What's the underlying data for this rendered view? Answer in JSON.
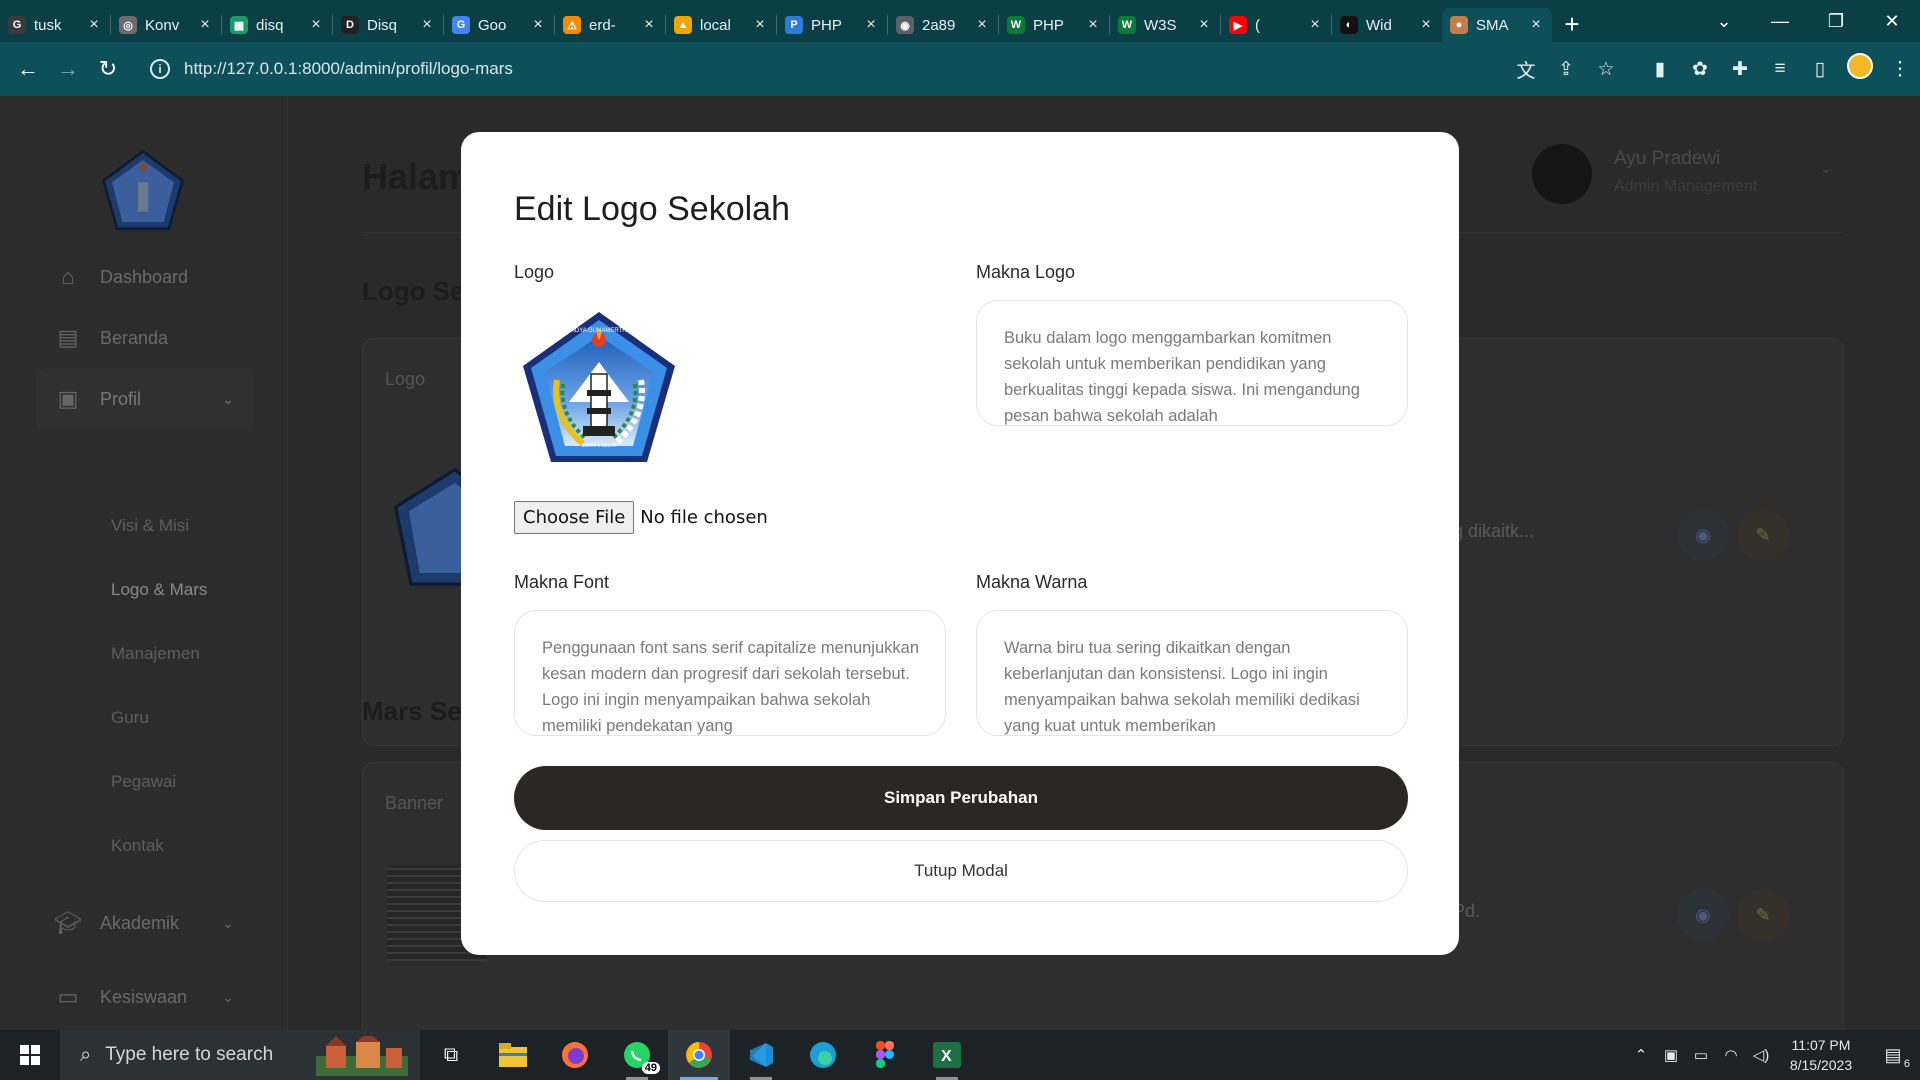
{
  "browser": {
    "tabs": [
      {
        "label": "tusk",
        "color": "#3a3a3a",
        "glyph": "G"
      },
      {
        "label": "Konv",
        "color": "#6b6b6b",
        "glyph": "◎"
      },
      {
        "label": "disq",
        "color": "#1a9c6a",
        "glyph": "▦"
      },
      {
        "label": "Disq",
        "color": "#222222",
        "glyph": "D"
      },
      {
        "label": "Goo",
        "color": "#4285f4",
        "glyph": "G"
      },
      {
        "label": "erd-",
        "color": "#f28b00",
        "glyph": "⚠"
      },
      {
        "label": "local",
        "color": "#f0a500",
        "glyph": "▲"
      },
      {
        "label": "PHP",
        "color": "#2d7ad8",
        "glyph": "P"
      },
      {
        "label": "2a89",
        "color": "#5a6066",
        "glyph": "◉"
      },
      {
        "label": "PHP",
        "color": "#0e7a3a",
        "glyph": "W"
      },
      {
        "label": "W3S",
        "color": "#0e7a3a",
        "glyph": "W"
      },
      {
        "label": "(",
        "color": "#ff0000",
        "glyph": "▶"
      },
      {
        "label": "Wid",
        "color": "#111111",
        "glyph": "◐"
      },
      {
        "label": "SMA",
        "color": "#c77a4a",
        "glyph": "●",
        "active": true
      }
    ],
    "new_tab": "+",
    "url": "http://127.0.0.1:8000/admin/profil/logo-mars"
  },
  "page": {
    "title": "Halam",
    "section_logo": "Logo Sek",
    "section_mars": "Mars Sel",
    "logo_card_header": "Logo",
    "logo_card_text": "g dikaitk...",
    "mars_card_header": "Banner",
    "mars_card_text": "Pd.",
    "user": {
      "name": "Ayu Pradewi",
      "role": "Admin Management"
    }
  },
  "sidebar": {
    "items": [
      {
        "label": "Dashboard",
        "icon": "home-icon"
      },
      {
        "label": "Beranda",
        "icon": "layout-icon"
      },
      {
        "label": "Profil",
        "icon": "profile-icon"
      },
      {
        "label": "Akademik",
        "icon": "graduation-cap-icon"
      },
      {
        "label": "Kesiswaan",
        "icon": "book-icon"
      }
    ],
    "sub_items": [
      "Visi & Misi",
      "Logo & Mars",
      "Manajemen",
      "Guru",
      "Pegawai",
      "Kontak"
    ]
  },
  "modal": {
    "title": "Edit Logo Sekolah",
    "logo_label": "Logo",
    "makna_logo_label": "Makna Logo",
    "makna_logo_text": "Buku dalam logo menggambarkan komitmen sekolah untuk memberikan pendidikan yang berkualitas tinggi kepada siswa. Ini mengandung pesan bahwa sekolah adalah",
    "file_button": "Choose File",
    "file_status": "No file chosen",
    "makna_font_label": "Makna Font",
    "makna_font_text": "Penggunaan font sans serif capitalize menunjukkan kesan modern dan progresif dari sekolah tersebut. Logo ini ingin menyampaikan bahwa sekolah memiliki pendekatan yang",
    "makna_warna_label": "Makna Warna",
    "makna_warna_text": "Warna biru tua sering dikaitkan dengan keberlanjutan dan konsistensi. Logo ini ingin menyampaikan bahwa sekolah memiliki dedikasi yang kuat untuk memberikan",
    "save_button": "Simpan Perubahan",
    "close_button": "Tutup Modal",
    "logo_text_top": "WIDYA GUNAMERTHA",
    "logo_text_bottom": "SMAN 1 SELAT"
  },
  "taskbar": {
    "search_placeholder": "Type here to search",
    "whatsapp_badge": "49",
    "time": "11:07 PM",
    "date": "8/15/2023",
    "notification_count": "6"
  },
  "colors": {
    "browser_tabbar": "#0b3f46",
    "browser_toolbar": "#0d5059",
    "primary_button": "#2a2826",
    "logo_blue": "#1f5fb8"
  }
}
